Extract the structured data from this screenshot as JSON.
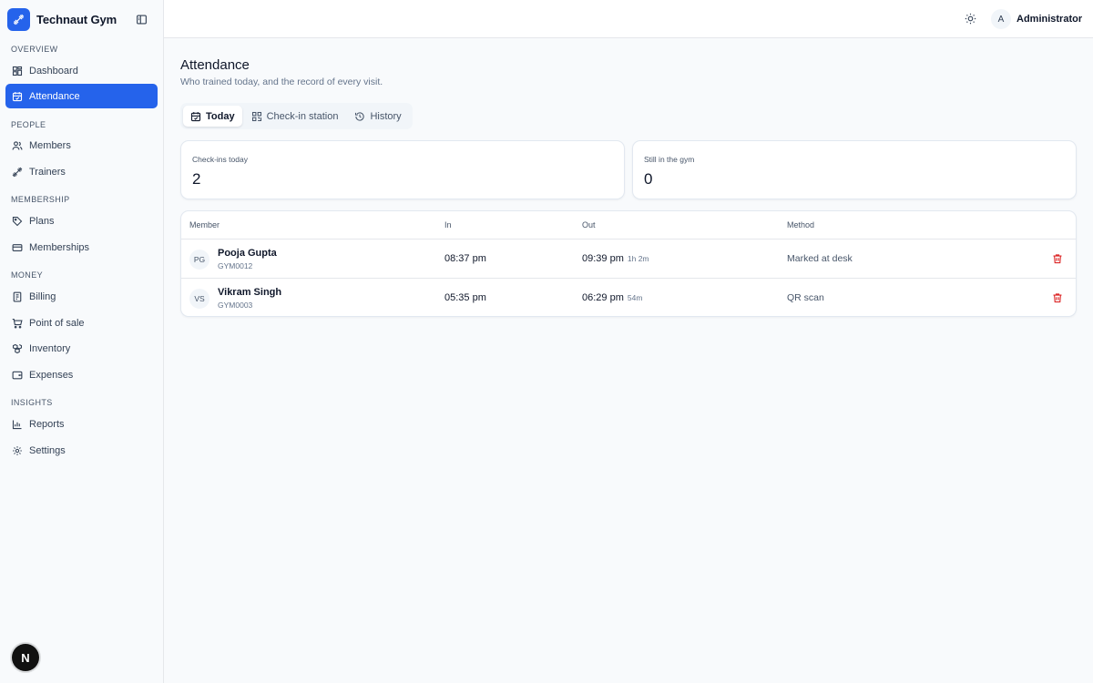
{
  "brand": {
    "name": "Technaut Gym"
  },
  "sidebar": {
    "sections": [
      {
        "label": "OVERVIEW"
      },
      {
        "label": "PEOPLE"
      },
      {
        "label": "MEMBERSHIP"
      },
      {
        "label": "MONEY"
      },
      {
        "label": "INSIGHTS"
      }
    ],
    "items": [
      {
        "label": "Dashboard",
        "icon": "dashboard-grid-icon"
      },
      {
        "label": "Attendance",
        "icon": "calendar-check-icon",
        "active": true
      },
      {
        "label": "Members",
        "icon": "users-icon"
      },
      {
        "label": "Trainers",
        "icon": "dumbbell-icon"
      },
      {
        "label": "Plans",
        "icon": "tag-icon"
      },
      {
        "label": "Memberships",
        "icon": "credit-card-icon"
      },
      {
        "label": "Billing",
        "icon": "receipt-icon"
      },
      {
        "label": "Point of sale",
        "icon": "shopping-cart-icon"
      },
      {
        "label": "Inventory",
        "icon": "boxes-icon"
      },
      {
        "label": "Expenses",
        "icon": "wallet-icon"
      },
      {
        "label": "Reports",
        "icon": "bar-chart-icon"
      },
      {
        "label": "Settings",
        "icon": "gear-icon"
      }
    ],
    "dev_badge": "N"
  },
  "topbar": {
    "user_initial": "A",
    "user_name": "Administrator"
  },
  "page": {
    "title": "Attendance",
    "subtitle": "Who trained today, and the record of every visit."
  },
  "tabs": [
    {
      "label": "Today",
      "icon": "calendar-check-icon",
      "active": true
    },
    {
      "label": "Check-in station",
      "icon": "qr-code-icon"
    },
    {
      "label": "History",
      "icon": "history-icon"
    }
  ],
  "stats": [
    {
      "label": "Check-ins today",
      "value": "2"
    },
    {
      "label": "Still in the gym",
      "value": "0"
    }
  ],
  "table": {
    "columns": [
      "Member",
      "In",
      "Out",
      "Method"
    ],
    "rows": [
      {
        "initials": "PG",
        "name": "Pooja Gupta",
        "id": "GYM0012",
        "in": "08:37 pm",
        "out": "09:39 pm",
        "duration": "1h 2m",
        "method": "Marked at desk"
      },
      {
        "initials": "VS",
        "name": "Vikram Singh",
        "id": "GYM0003",
        "in": "05:35 pm",
        "out": "06:29 pm",
        "duration": "54m",
        "method": "QR scan"
      }
    ]
  },
  "colors": {
    "accent": "#2563eb",
    "danger": "#dc2626"
  }
}
